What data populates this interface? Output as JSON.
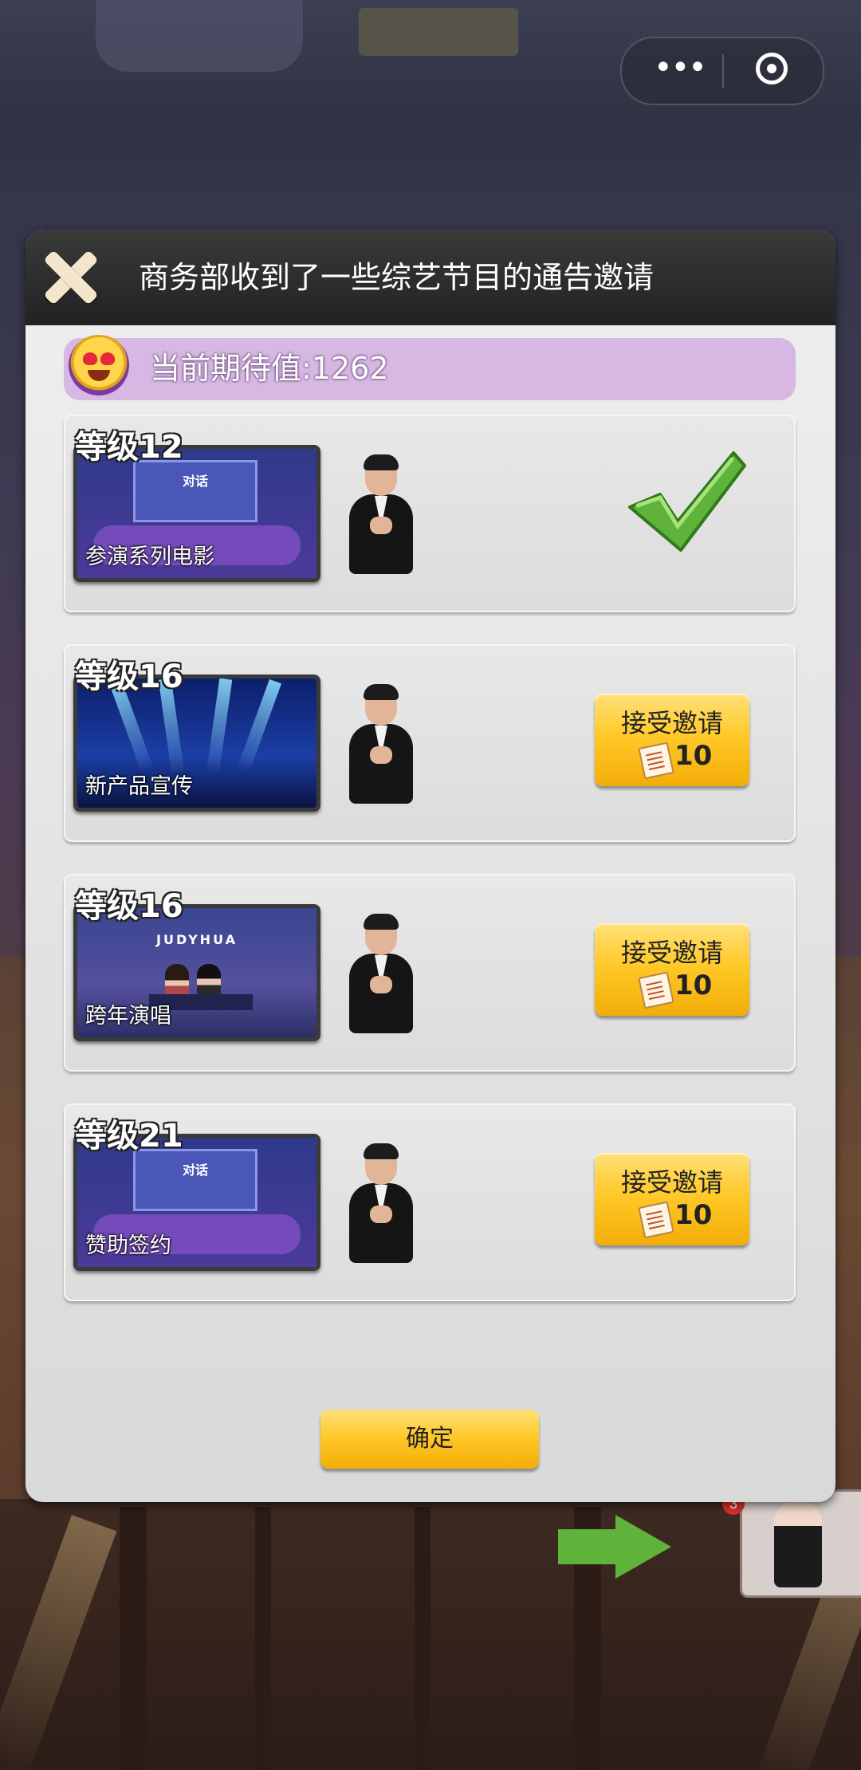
{
  "dialog": {
    "title": "商务部收到了一些综艺节目的通告邀请",
    "expectation": "当前期待值:1262",
    "confirm_label": "确定"
  },
  "offers": [
    {
      "level": "等级12",
      "name": "参演系列电影",
      "screen_text": "对话",
      "status": "accepted"
    },
    {
      "level": "等级16",
      "name": "新产品宣传",
      "status": "available",
      "accept_label": "接受邀请",
      "cost": "10"
    },
    {
      "level": "等级16",
      "name": "跨年演唱",
      "screen_text": "JUDYHUA",
      "status": "available",
      "accept_label": "接受邀请",
      "cost": "10"
    },
    {
      "level": "等级21",
      "name": "赞助签约",
      "screen_text": "对话",
      "status": "available",
      "accept_label": "接受邀请",
      "cost": "10"
    }
  ],
  "background": {
    "notification_count": "3"
  },
  "colors": {
    "accent_button": "#ffc929",
    "check_green": "#5fb33a",
    "expect_bar": "#d6b8e3",
    "header": "#2a2a2a"
  },
  "icons": [
    "close-icon",
    "heart-eyes-emoji-icon",
    "check-icon",
    "ticket-icon",
    "more-icon",
    "target-icon",
    "arrow-right-icon"
  ]
}
